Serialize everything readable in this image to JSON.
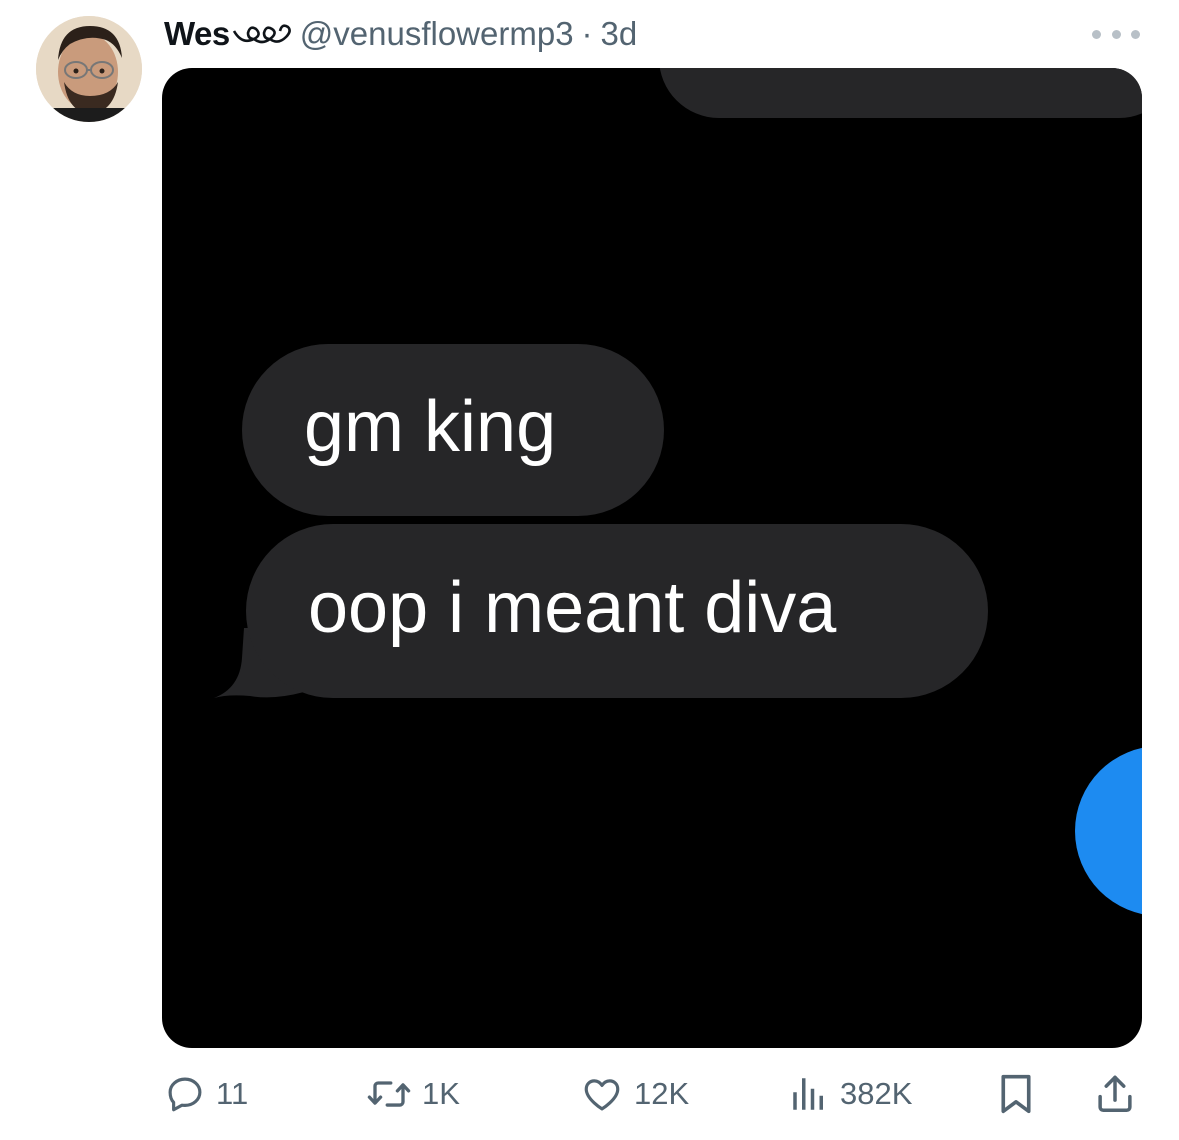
{
  "tweet": {
    "display_name": "Wes",
    "handle": "@venusflowermp3",
    "separator": "·",
    "time": "3d",
    "media": {
      "messages": [
        "gm king",
        "oop i meant diva"
      ]
    },
    "actions": {
      "replies": "11",
      "retweets": "1K",
      "likes": "12K",
      "views": "382K"
    }
  },
  "icons": {
    "reply": "reply-icon",
    "retweet": "retweet-icon",
    "like": "heart-icon",
    "views": "views-icon",
    "bookmark": "bookmark-icon",
    "share": "share-icon",
    "more": "more-icon"
  },
  "colors": {
    "secondary_text": "#536471",
    "bubble": "#262628",
    "media_background": "#000000",
    "blue_dot": "#1d8bf1"
  }
}
